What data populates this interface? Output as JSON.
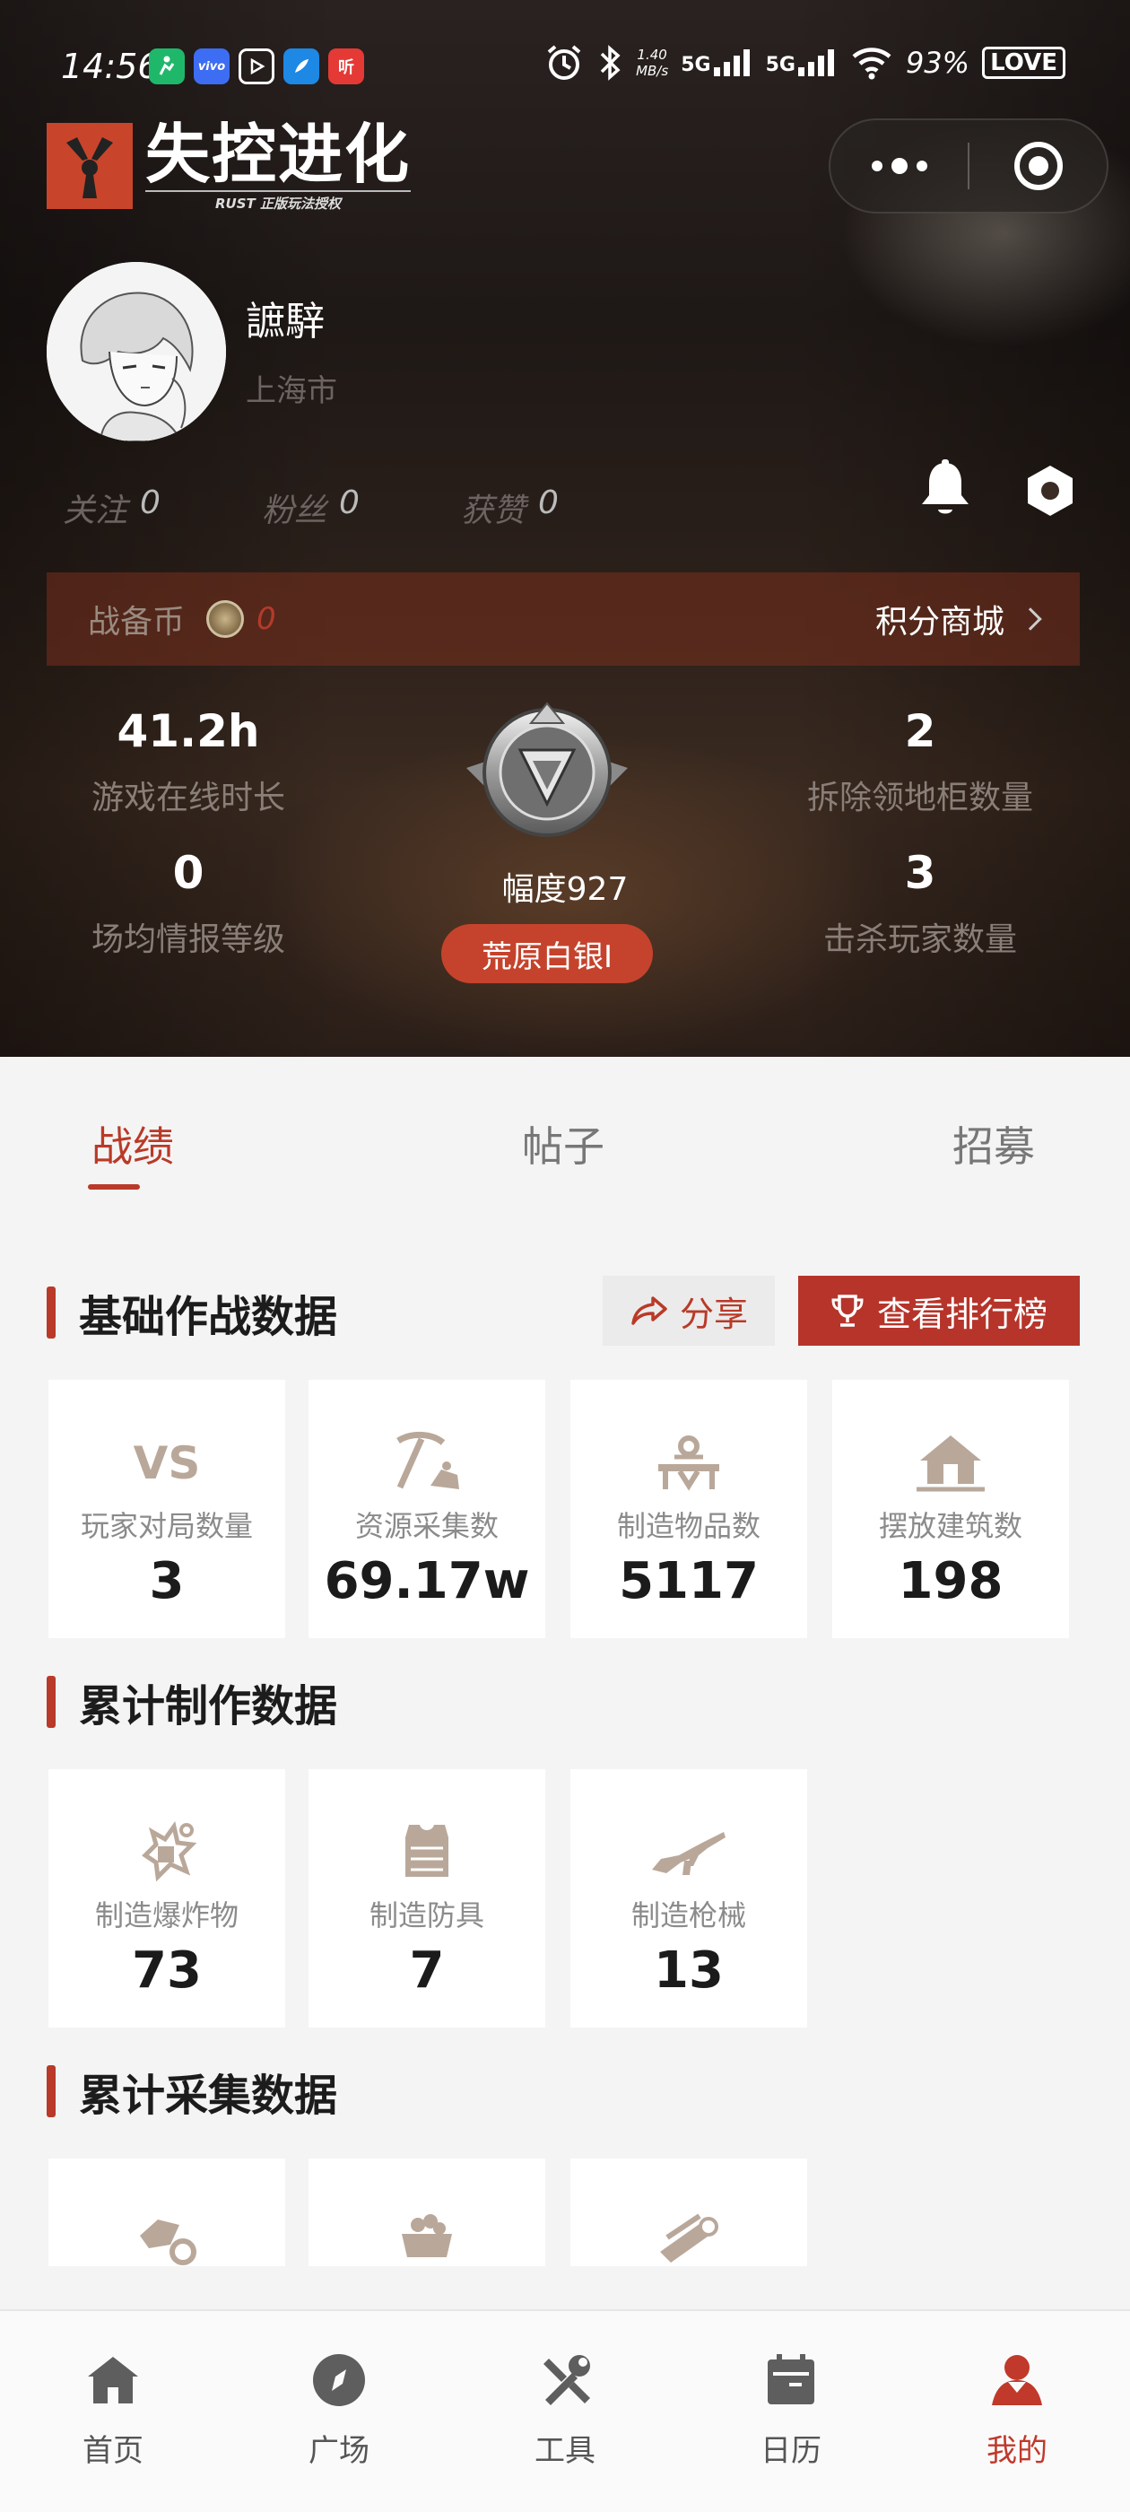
{
  "status_bar": {
    "time": "14:56",
    "apps": [
      {
        "icon": "fitness-app-icon",
        "text": "",
        "color": "#1fb86a"
      },
      {
        "icon": "vivo-app-icon",
        "text": "vivo",
        "color": "#3d6df2"
      },
      {
        "icon": "video-app-icon",
        "text": "",
        "color": "#333333"
      },
      {
        "icon": "feather-app-icon",
        "text": "",
        "color": "#1e88e5"
      },
      {
        "icon": "listen-app-icon",
        "text": "听",
        "color": "#e53935"
      }
    ],
    "net_speed_top": "1.40",
    "net_speed_unit": "MB/s",
    "signal1": "5G",
    "signal2": "5G",
    "battery": "93%",
    "love_badge": "LOVE"
  },
  "brand": {
    "name": "失控进化",
    "subtitle": "RUST 正版玩法授权",
    "accent": "#c8452b"
  },
  "profile": {
    "username": "謶騂",
    "location": "上海市",
    "follow": [
      {
        "label": "关注",
        "value": "0"
      },
      {
        "label": "粉丝",
        "value": "0"
      },
      {
        "label": "获赞",
        "value": "0"
      }
    ]
  },
  "coins": {
    "label": "战备币",
    "value": "0",
    "shop_label": "积分商城"
  },
  "stats": {
    "online_hours": {
      "value": "41.2h",
      "label": "游戏在线时长"
    },
    "intel_level": {
      "value": "0",
      "label": "场均情报等级"
    },
    "demolish": {
      "value": "2",
      "label": "拆除领地柜数量"
    },
    "kills": {
      "value": "3",
      "label": "击杀玩家数量"
    }
  },
  "rank": {
    "degree": "幅度927",
    "tier": "荒原白银I"
  },
  "tabs": [
    {
      "label": "战绩",
      "active": true
    },
    {
      "label": "帖子",
      "active": false
    },
    {
      "label": "招募",
      "active": false
    }
  ],
  "sections": {
    "basic": {
      "title": "基础作战数据",
      "share_label": "分享",
      "leaderboard_label": "查看排行榜",
      "cards": [
        {
          "icon": "vs-icon",
          "label": "玩家对局数量",
          "value": "3"
        },
        {
          "icon": "pickaxe-icon",
          "label": "资源采集数",
          "value": "69.17w"
        },
        {
          "icon": "workbench-icon",
          "label": "制造物品数",
          "value": "5117"
        },
        {
          "icon": "house-icon",
          "label": "摆放建筑数",
          "value": "198"
        }
      ]
    },
    "crafting": {
      "title": "累计制作数据",
      "cards": [
        {
          "icon": "explosive-icon",
          "label": "制造爆炸物",
          "value": "73"
        },
        {
          "icon": "armor-icon",
          "label": "制造防具",
          "value": "7"
        },
        {
          "icon": "rifle-icon",
          "label": "制造枪械",
          "value": "13"
        }
      ]
    },
    "gathering": {
      "title": "累计采集数据",
      "cards": [
        {
          "icon": "ore-icon"
        },
        {
          "icon": "minecart-icon"
        },
        {
          "icon": "wood-logs-icon"
        }
      ]
    }
  },
  "nav": [
    {
      "icon": "home-icon",
      "label": "首页",
      "active": false
    },
    {
      "icon": "compass-icon",
      "label": "广场",
      "active": false
    },
    {
      "icon": "tools-icon",
      "label": "工具",
      "active": false
    },
    {
      "icon": "calendar-icon",
      "label": "日历",
      "active": false
    },
    {
      "icon": "profile-icon",
      "label": "我的",
      "active": true
    }
  ],
  "colors": {
    "accent_red": "#b93a28",
    "icon_tan": "#b9a89a",
    "nav_gray": "#5e5e5e"
  }
}
